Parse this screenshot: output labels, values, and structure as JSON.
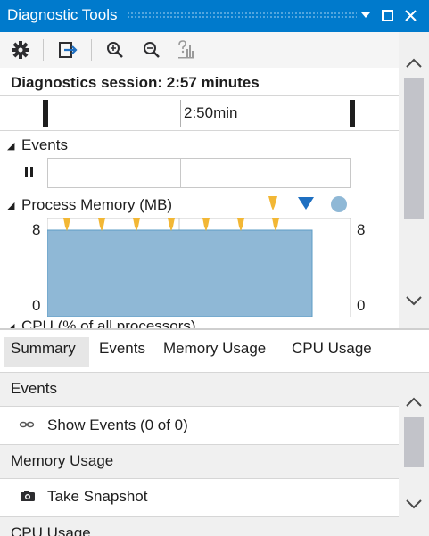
{
  "window": {
    "title": "Diagnostic Tools"
  },
  "session": {
    "label": "Diagnostics session: 2:57 minutes"
  },
  "timeline": {
    "tick_label": "2:50min"
  },
  "events_track": {
    "title": "Events"
  },
  "memory": {
    "title": "Process Memory (MB)",
    "y_max": "8",
    "y_min": "0",
    "legend_colors": {
      "gc": "#f2b735",
      "snapshot": "#1e6fc1",
      "private_bytes": "#8fb8d6"
    }
  },
  "cpu_partial_title": "CPU (% of all processors)",
  "chart_data": {
    "type": "area",
    "title": "Process Memory (MB)",
    "ylim": [
      0,
      8
    ],
    "series": [
      {
        "values": [
          8,
          8
        ]
      }
    ]
  },
  "tabs": [
    {
      "label": "Summary"
    },
    {
      "label": "Events"
    },
    {
      "label": "Memory Usage"
    },
    {
      "label": "CPU Usage"
    }
  ],
  "summary": {
    "events_header": "Events",
    "show_events": "Show Events (0 of 0)",
    "memory_header": "Memory Usage",
    "take_snapshot": "Take Snapshot",
    "cpu_header": "CPU Usage"
  }
}
